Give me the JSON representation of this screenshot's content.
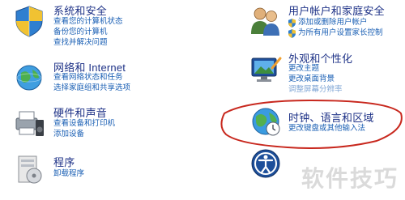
{
  "left": [
    {
      "title": "系统和安全",
      "links": [
        "查看您的计算机状态",
        "备份您的计算机",
        "查找并解决问题"
      ],
      "icon": "system-security-icon"
    },
    {
      "title": "网络和 Internet",
      "links": [
        "查看网络状态和任务",
        "选择家庭组和共享选项"
      ],
      "icon": "network-icon"
    },
    {
      "title": "硬件和声音",
      "links": [
        "查看设备和打印机",
        "添加设备"
      ],
      "icon": "hardware-sound-icon"
    },
    {
      "title": "程序",
      "links": [
        "卸载程序"
      ],
      "icon": "programs-icon"
    }
  ],
  "right": [
    {
      "title": "用户帐户和家庭安全",
      "links": [
        "添加或删除用户帐户",
        "为所有用户设置家长控制"
      ],
      "icon": "user-accounts-icon"
    },
    {
      "title": "外观和个性化",
      "links": [
        "更改主题",
        "更改桌面背景",
        "调整屏幕分辨率"
      ],
      "icon": "appearance-icon"
    },
    {
      "title": "时钟、语言和区域",
      "links": [
        "更改键盘或其他输入法"
      ],
      "icon": "clock-region-icon"
    },
    {
      "title": "",
      "links": [],
      "icon": "ease-of-access-icon"
    }
  ],
  "watermark": "软件技巧",
  "annotation_color": "#c8281e"
}
